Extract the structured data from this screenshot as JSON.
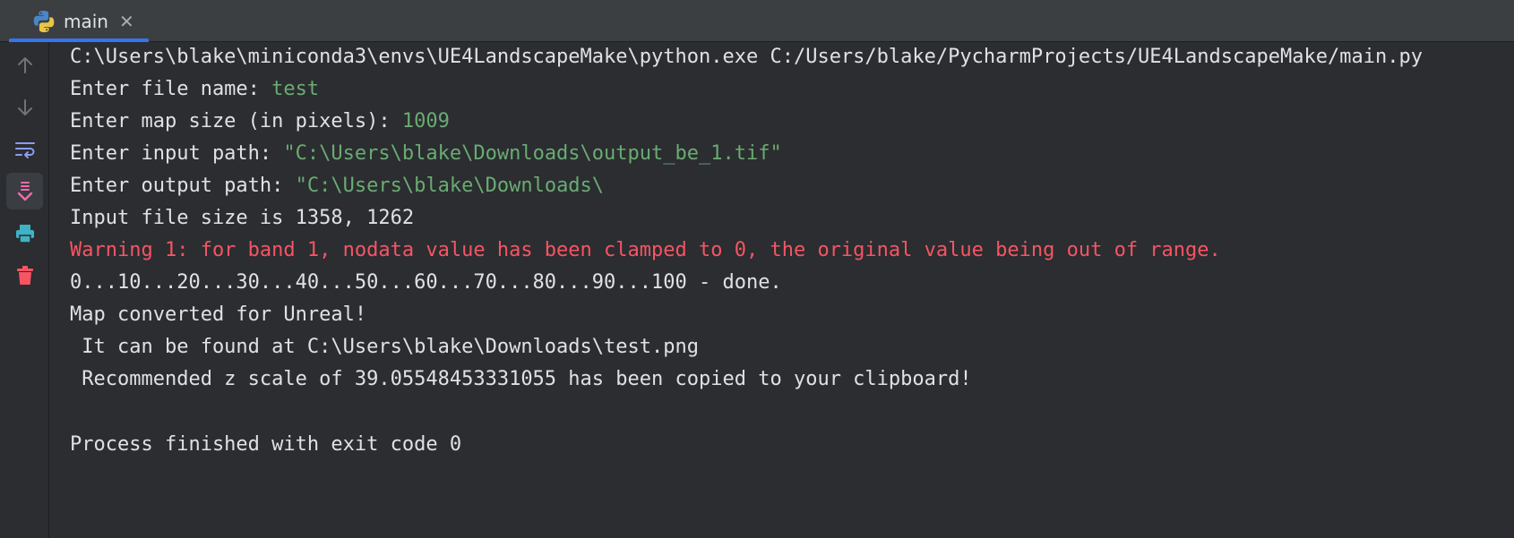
{
  "tab": {
    "label": "main",
    "close": "✕",
    "icon": "python-icon"
  },
  "toolbar": [
    {
      "name": "up-arrow-icon",
      "active": false
    },
    {
      "name": "down-arrow-icon",
      "active": false
    },
    {
      "name": "soft-wrap-icon",
      "active": false
    },
    {
      "name": "scroll-to-end-icon",
      "active": true
    },
    {
      "name": "print-icon",
      "active": false
    },
    {
      "name": "trash-icon",
      "active": false
    }
  ],
  "console": {
    "cmd": "C:\\Users\\blake\\miniconda3\\envs\\UE4LandscapeMake\\python.exe C:/Users/blake/PycharmProjects/UE4LandscapeMake/main.py",
    "prompt1": "Enter file name: ",
    "input1": "test",
    "prompt2": "Enter map size (in pixels): ",
    "input2": "1009",
    "prompt3": "Enter input path: ",
    "input3": "\"C:\\Users\\blake\\Downloads\\output_be_1.tif\"",
    "prompt4": "Enter output path: ",
    "input4": "\"C:\\Users\\blake\\Downloads\\",
    "line5": "Input file size is 1358, 1262",
    "warning": "Warning 1: for band 1, nodata value has been clamped to 0, the original value being out of range.",
    "progress": "0...10...20...30...40...50...60...70...80...90...100 - done.",
    "converted": "Map converted for Unreal!",
    "found": " It can be found at C:\\Users\\blake\\Downloads\\test.png",
    "recommended": " Recommended z scale of 39.05548453331055 has been copied to your clipboard!",
    "finished": "Process finished with exit code 0"
  },
  "colors": {
    "background": "#2b2d30",
    "text": "#dfe1e5",
    "user_input": "#6aab73",
    "error": "#f75464",
    "accent": "#3574f0"
  }
}
